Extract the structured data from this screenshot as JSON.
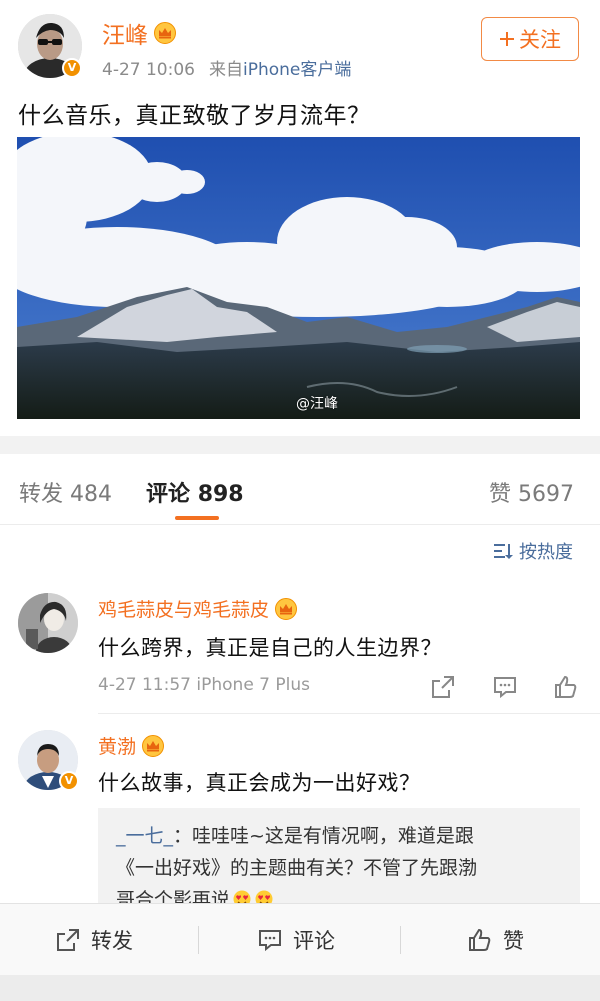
{
  "post": {
    "author": "汪峰",
    "date": "4-27 10:06",
    "source_prefix": "来自",
    "source_link": "iPhone客户端",
    "follow_label": "关注",
    "text": "什么音乐，真正致敬了岁月流年？",
    "image_watermark": "@汪峰"
  },
  "tabs": {
    "repost": {
      "label": "转发",
      "count": "484"
    },
    "comment": {
      "label": "评论",
      "count": "898"
    },
    "like": {
      "label": "赞",
      "count": "5697"
    }
  },
  "sort_label": "按热度",
  "comments": [
    {
      "name": "鸡毛蒜皮与鸡毛蒜皮",
      "text": "什么跨界，真正是自己的人生边界？",
      "date": "4-27 11:57",
      "device": "iPhone 7 Plus"
    },
    {
      "name": "黄渤",
      "text": "什么故事，真正会成为一出好戏？",
      "reply": {
        "user": "_一七_",
        "text_line1": "：哇哇哇~这是有情况啊，难道是跟",
        "text_line2": "《一出好戏》的主题曲有关？不管了先跟渤",
        "text_line3": "哥合个影再说"
      }
    }
  ],
  "bottom_bar": {
    "repost_label": "转发",
    "comment_label": "评论",
    "like_label": "赞"
  },
  "colors": {
    "accent_orange": "#f37021",
    "link_blue": "#4a6d9c",
    "verified_badge": "#f29100"
  }
}
